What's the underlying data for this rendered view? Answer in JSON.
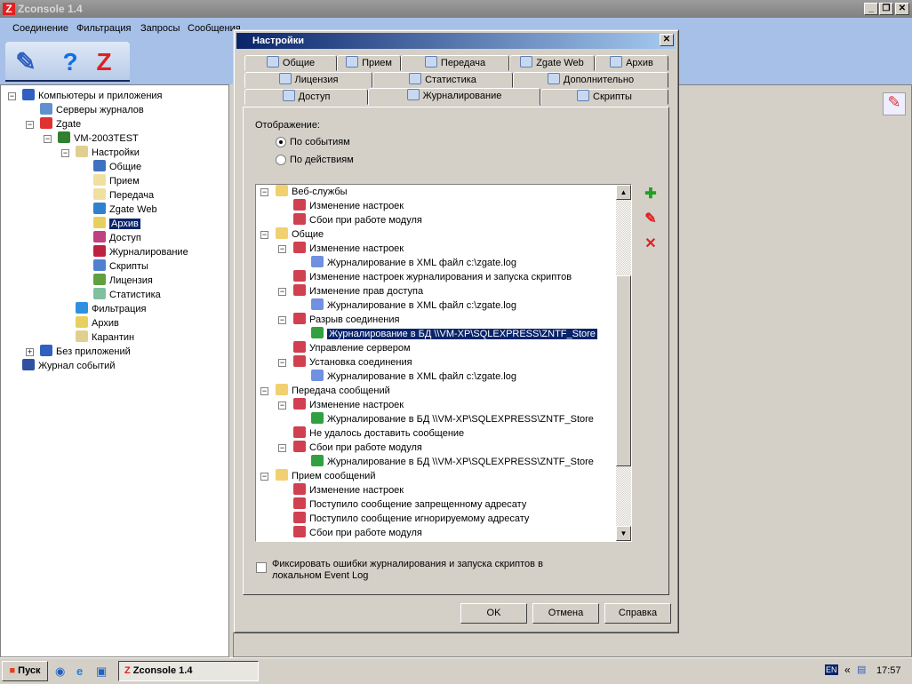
{
  "window": {
    "title": "Zconsole 1.4",
    "minimize": "_",
    "restore": "❐",
    "close": "✕"
  },
  "menu": [
    "Соединение",
    "Фильтрация",
    "Запросы",
    "Сообщения"
  ],
  "toolbar": [
    {
      "icon": "edit-list-icon",
      "glyph": "✎"
    },
    {
      "icon": "help-icon",
      "glyph": "?"
    },
    {
      "icon": "zgate-icon",
      "glyph": "Z"
    }
  ],
  "left_tree": [
    {
      "label": "Компьютеры и приложения",
      "level": 0,
      "toggle": "−",
      "icon": "computer-icon",
      "color": "#3060c0"
    },
    {
      "label": "Серверы журналов",
      "level": 1,
      "icon": "servers-icon",
      "color": "#6090d0"
    },
    {
      "label": "Zgate",
      "level": 1,
      "toggle": "−",
      "icon": "zgate-icon",
      "color": "#e03030"
    },
    {
      "label": "VM-2003TEST",
      "level": 2,
      "toggle": "−",
      "icon": "server-icon",
      "color": "#308030"
    },
    {
      "label": "Настройки",
      "level": 3,
      "toggle": "−",
      "icon": "settings-icon",
      "color": "#e0d090"
    },
    {
      "label": "Общие",
      "level": 4,
      "icon": "general-icon",
      "color": "#4070c0"
    },
    {
      "label": "Прием",
      "level": 4,
      "icon": "receive-mail-icon",
      "color": "#f0e0a0"
    },
    {
      "label": "Передача",
      "level": 4,
      "icon": "send-mail-icon",
      "color": "#f0e0a0"
    },
    {
      "label": "Zgate Web",
      "level": 4,
      "icon": "globe-icon",
      "color": "#3080d0"
    },
    {
      "label": "Архив",
      "level": 4,
      "icon": "archive-icon",
      "color": "#e8d060",
      "selected": true
    },
    {
      "label": "Доступ",
      "level": 4,
      "icon": "access-icon",
      "color": "#c04080"
    },
    {
      "label": "Журналирование",
      "level": 4,
      "icon": "book-icon",
      "color": "#c02040"
    },
    {
      "label": "Скрипты",
      "level": 4,
      "icon": "scripts-icon",
      "color": "#5080d0"
    },
    {
      "label": "Лицензия",
      "level": 4,
      "icon": "license-icon",
      "color": "#60a040"
    },
    {
      "label": "Статистика",
      "level": 4,
      "icon": "statistics-icon",
      "color": "#80c0a0"
    },
    {
      "label": "Фильтрация",
      "level": 3,
      "icon": "filter-icon",
      "color": "#3090e0"
    },
    {
      "label": "Архив",
      "level": 3,
      "icon": "archive-icon",
      "color": "#e8d060"
    },
    {
      "label": "Карантин",
      "level": 3,
      "icon": "quarantine-icon",
      "color": "#e0d090"
    },
    {
      "label": "Без приложений",
      "level": 1,
      "toggle": "+",
      "icon": "computer-icon",
      "color": "#3060c0"
    },
    {
      "label": "Журнал событий",
      "level": 0,
      "icon": "event-log-icon",
      "color": "#3050a0"
    }
  ],
  "dialog": {
    "title": "Настройки",
    "close": "✕",
    "tabs_row1": [
      "Общие",
      "Прием",
      "Передача",
      "Zgate Web",
      "Архив"
    ],
    "tabs_row2": [
      "Лицензия",
      "Статистика",
      "Дополнительно"
    ],
    "tabs_row3": [
      "Доступ",
      "Журналирование",
      "Скрипты"
    ],
    "active_tab": "Журналирование",
    "display_label": "Отображение:",
    "radio_events": "По событиям",
    "radio_actions": "По действиям",
    "radio_selected": "По событиям",
    "log_tree": [
      {
        "label": "Веб-службы",
        "level": 0,
        "type": "folder",
        "toggle": "−"
      },
      {
        "label": "Изменение настроек",
        "level": 1,
        "type": "event"
      },
      {
        "label": "Сбои при работе модуля",
        "level": 1,
        "type": "event"
      },
      {
        "label": "Общие",
        "level": 0,
        "type": "folder",
        "toggle": "−"
      },
      {
        "label": "Изменение настроек",
        "level": 1,
        "type": "event",
        "toggle": "−"
      },
      {
        "label": "Журналирование в XML файл c:\\zgate.log",
        "level": 2,
        "type": "xml"
      },
      {
        "label": "Изменение настроек журналирования и запуска скриптов",
        "level": 1,
        "type": "event"
      },
      {
        "label": "Изменение прав доступа",
        "level": 1,
        "type": "event",
        "toggle": "−"
      },
      {
        "label": "Журналирование в XML файл c:\\zgate.log",
        "level": 2,
        "type": "xml"
      },
      {
        "label": "Разрыв соединения",
        "level": 1,
        "type": "event",
        "toggle": "−"
      },
      {
        "label": "Журналирование в БД \\\\VM-XP\\SQLEXPRESS\\ZNTF_Store",
        "level": 2,
        "type": "db",
        "selected": true
      },
      {
        "label": "Управление сервером",
        "level": 1,
        "type": "event"
      },
      {
        "label": "Установка соединения",
        "level": 1,
        "type": "event",
        "toggle": "−"
      },
      {
        "label": "Журналирование в XML файл c:\\zgate.log",
        "level": 2,
        "type": "xml"
      },
      {
        "label": "Передача сообщений",
        "level": 0,
        "type": "folder",
        "toggle": "−"
      },
      {
        "label": "Изменение настроек",
        "level": 1,
        "type": "event",
        "toggle": "−"
      },
      {
        "label": "Журналирование в БД \\\\VM-XP\\SQLEXPRESS\\ZNTF_Store",
        "level": 2,
        "type": "db"
      },
      {
        "label": "Не удалось доставить сообщение",
        "level": 1,
        "type": "event"
      },
      {
        "label": "Сбои при работе модуля",
        "level": 1,
        "type": "event",
        "toggle": "−"
      },
      {
        "label": "Журналирование в БД \\\\VM-XP\\SQLEXPRESS\\ZNTF_Store",
        "level": 2,
        "type": "db"
      },
      {
        "label": "Прием сообщений",
        "level": 0,
        "type": "folder",
        "toggle": "−"
      },
      {
        "label": "Изменение настроек",
        "level": 1,
        "type": "event"
      },
      {
        "label": "Поступило сообщение запрещенному адресату",
        "level": 1,
        "type": "event"
      },
      {
        "label": "Поступило сообщение игнорируемому адресату",
        "level": 1,
        "type": "event"
      },
      {
        "label": "Сбои при работе модуля",
        "level": 1,
        "type": "event"
      }
    ],
    "side_buttons": [
      {
        "icon": "add-icon",
        "glyph": "✚",
        "color": "#20a020"
      },
      {
        "icon": "edit-icon",
        "glyph": "✎",
        "color": "#e02020"
      },
      {
        "icon": "delete-icon",
        "glyph": "✕",
        "color": "#e02020"
      }
    ],
    "checkbox_label": "Фиксировать ошибки журналирования и запуска скриптов в локальном Event Log",
    "checkbox_checked": false,
    "ok": "OK",
    "cancel": "Отмена",
    "help": "Справка"
  },
  "taskbar": {
    "start": "Пуск",
    "task": "Zconsole 1.4",
    "lang": "EN",
    "chevron": "«",
    "clock": "17:57"
  }
}
